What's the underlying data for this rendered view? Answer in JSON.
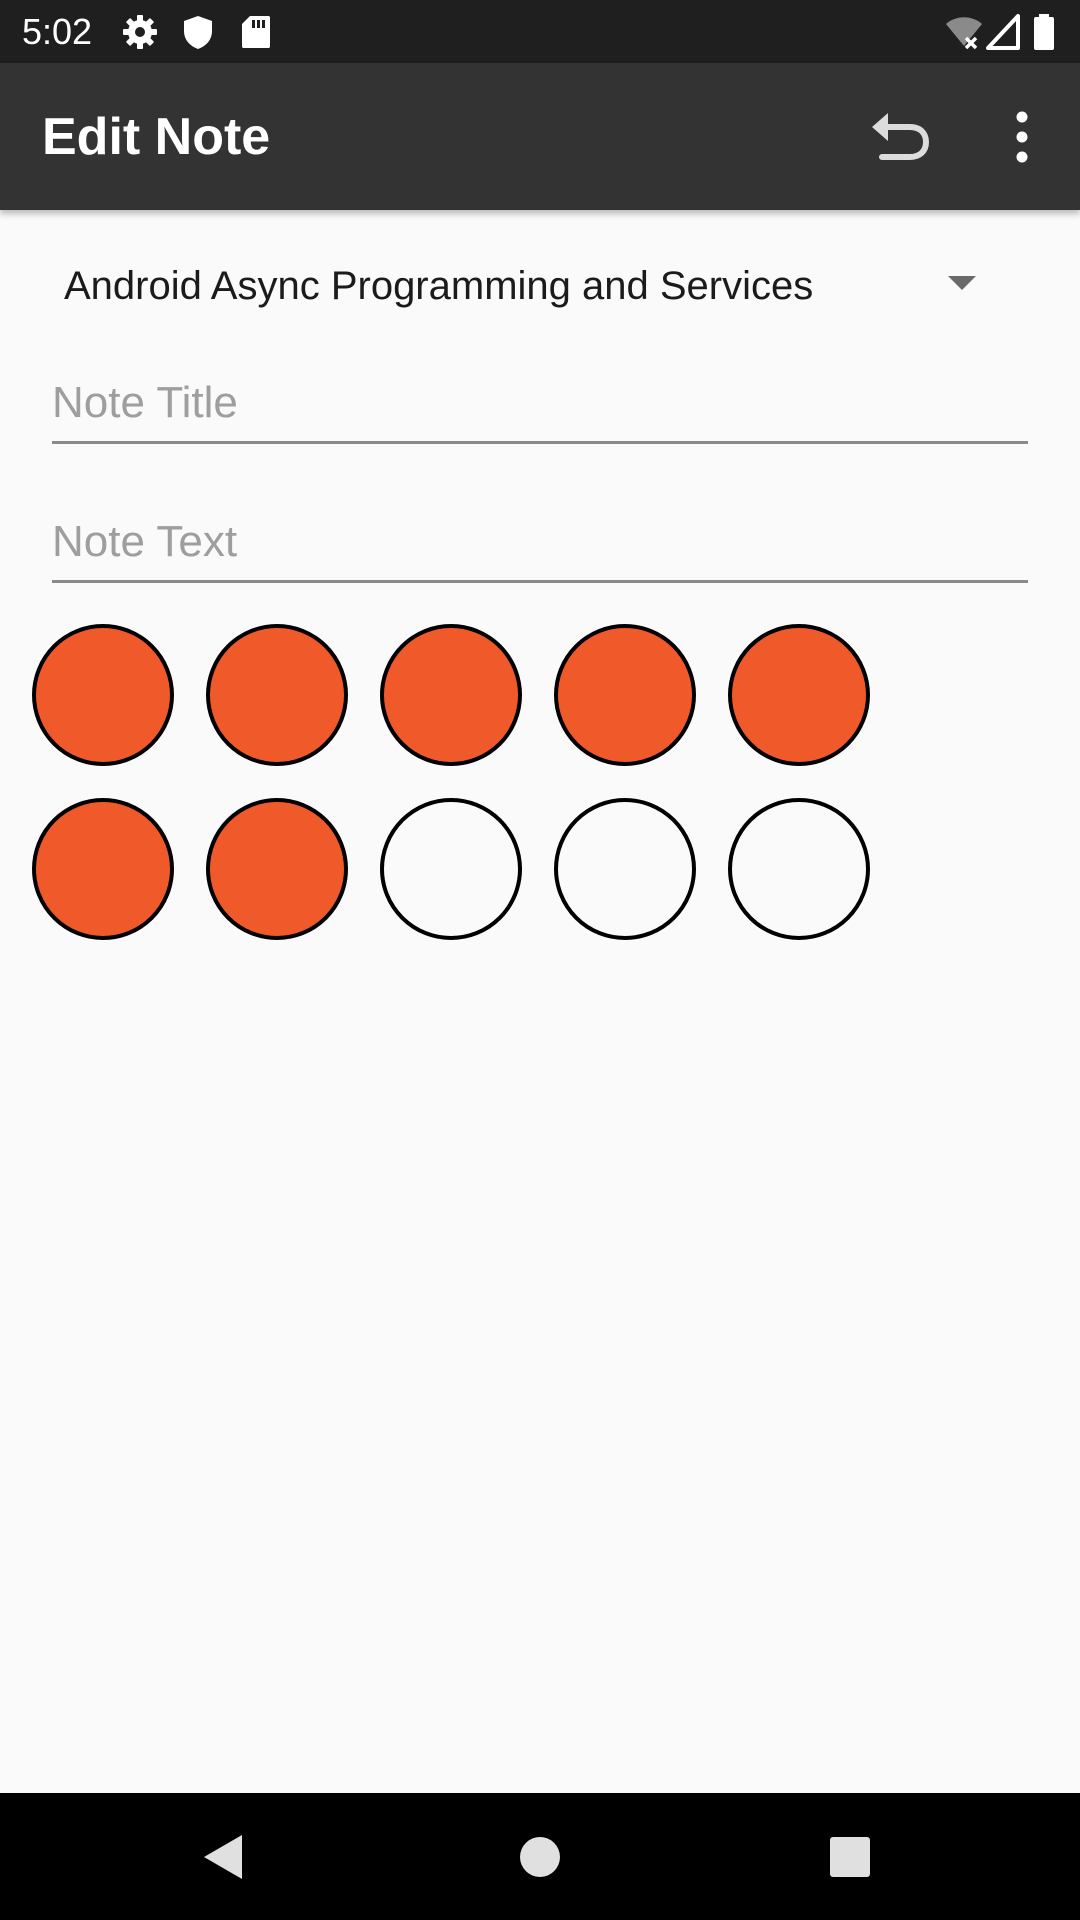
{
  "status_bar": {
    "time": "5:02",
    "icons": [
      "settings-icon",
      "shield-icon",
      "sd-card-icon",
      "wifi-off-icon",
      "signal-icon",
      "battery-icon"
    ]
  },
  "app_bar": {
    "title": "Edit Note",
    "actions": [
      "undo-icon",
      "more-vert-icon"
    ],
    "background": "#333333"
  },
  "course_spinner": {
    "selected": "Android Async Programming and Services"
  },
  "note_title": {
    "value": "",
    "placeholder": "Note Title"
  },
  "note_text": {
    "value": "",
    "placeholder": "Note Text"
  },
  "progress_dots": {
    "total": 10,
    "filled": 7,
    "fill_color": "#f05a2b",
    "empty_color": "#fafafa",
    "border_color": "#000000"
  },
  "nav_bar": {
    "buttons": [
      "back-icon",
      "home-icon",
      "recents-icon"
    ]
  }
}
